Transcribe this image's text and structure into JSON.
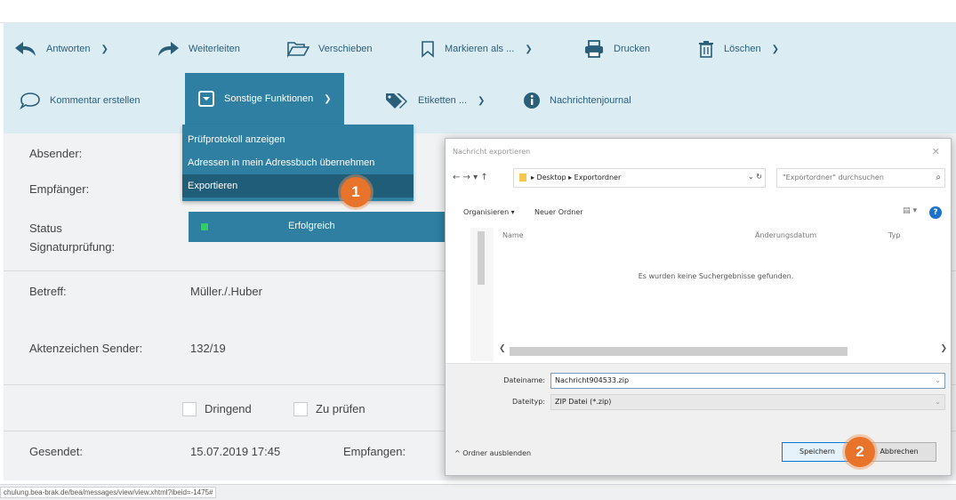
{
  "toolbar": {
    "row1": [
      {
        "label": "Antworten",
        "icon": "reply-icon",
        "has_dropdown": true
      },
      {
        "label": "Weiterleiten",
        "icon": "forward-icon",
        "has_dropdown": false
      },
      {
        "label": "Verschieben",
        "icon": "folder-open-icon",
        "has_dropdown": false
      },
      {
        "label": "Markieren als ...",
        "icon": "bookmark-icon",
        "has_dropdown": true
      },
      {
        "label": "Drucken",
        "icon": "printer-icon",
        "has_dropdown": false
      },
      {
        "label": "Löschen",
        "icon": "trash-icon",
        "has_dropdown": true
      }
    ],
    "row2": [
      {
        "label": "Kommentar erstellen",
        "icon": "comment-icon",
        "has_dropdown": false
      },
      {
        "label": "Sonstige Funktionen",
        "icon": "dropdown-box-icon",
        "has_dropdown": true,
        "active": true
      },
      {
        "label": "Etiketten ...",
        "icon": "tags-icon",
        "has_dropdown": true
      },
      {
        "label": "Nachrichtenjournal",
        "icon": "info-icon",
        "has_dropdown": false
      }
    ],
    "accent_color": "#2e7fa1",
    "background_color": "#dcecf3"
  },
  "menu": {
    "items": [
      {
        "label": "Prüfprotokoll anzeigen",
        "selected": false
      },
      {
        "label": "Adressen in mein Adressbuch übernehmen",
        "selected": false
      },
      {
        "label": "Exportieren",
        "selected": true
      }
    ]
  },
  "badges": {
    "one": "1",
    "two": "2",
    "color": "#e8742c"
  },
  "message": {
    "sender_label": "Absender:",
    "recipient_label": "Empfänger:",
    "signature_label": "Status Signaturprüfung:",
    "signature_status": "Erfolgreich",
    "subject_label": "Betreff:",
    "subject_value": "Müller./.Huber",
    "reference_label": "Aktenzeichen Sender:",
    "reference_value": "132/19",
    "urgent_label": "Dringend",
    "check_label": "Zu prüfen",
    "sent_label": "Gesendet:",
    "sent_value": "15.07.2019 17:45",
    "received_label": "Empfangen:"
  },
  "statusbar": {
    "url": "chulung.bea-brak.de/bea/messages/view/view.xhtml?ibeid=-1475#"
  },
  "dialog": {
    "title": "Nachricht exportieren",
    "close": "✕",
    "nav": "←  →  ▾  ↑",
    "path": "▸ Desktop ▸ Exportordner",
    "refresh": "⌄  ↻",
    "search_placeholder": "\"Exportordner\" durchsuchen",
    "organize": "Organisieren ▾",
    "new_folder": "Neuer Ordner",
    "view": "▤ ▾",
    "help": "?",
    "col_name": "Name",
    "col_date": "Änderungsdatum",
    "col_type": "Typ",
    "empty_text": "Es wurden keine Suchergebnisse gefunden.",
    "filename_label": "Dateiname:",
    "filename_value": "Nachricht904533.zip",
    "filetype_label": "Dateityp:",
    "filetype_value": "ZIP Datei (*.zip)",
    "hide_folders": "^ Ordner ausblenden",
    "save_button": "Speichern",
    "cancel_button": "Abbrechen"
  }
}
